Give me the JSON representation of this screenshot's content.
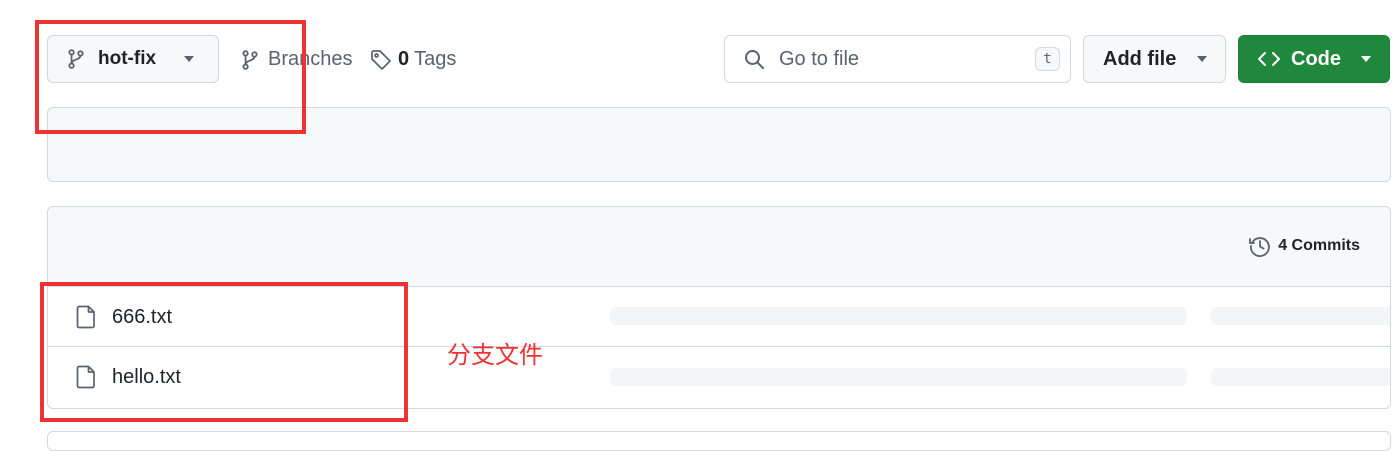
{
  "toolbar": {
    "branch_name": "hot-fix",
    "branches_label": "Branches",
    "tags_count": "0",
    "tags_label": "Tags",
    "search_placeholder": "Go to file",
    "search_shortcut": "t",
    "add_file_label": "Add file",
    "code_label": "Code"
  },
  "files_panel": {
    "commits_label": "4 Commits",
    "files": [
      {
        "name": "666.txt",
        "icon": "file-icon"
      },
      {
        "name": "hello.txt",
        "icon": "file-icon"
      }
    ]
  },
  "annotation": {
    "text": "分支文件",
    "color": "#ee3334"
  },
  "colors": {
    "code_button": "#1f883d",
    "border": "#d1d9e0",
    "muted_bg": "#f6f8fa"
  }
}
